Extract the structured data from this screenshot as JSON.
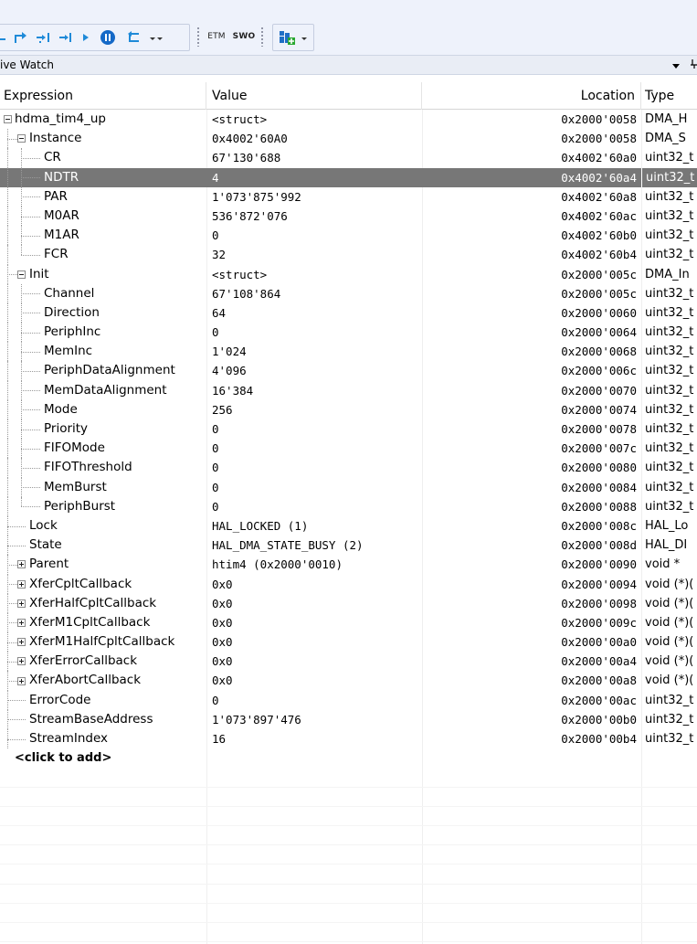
{
  "toolbar": {
    "etm_label": "ETM",
    "swo_label": "SWO"
  },
  "panel": {
    "title": "ive Watch"
  },
  "columns": {
    "expression": "Expression",
    "value": "Value",
    "location": "Location",
    "type": "Type"
  },
  "rows": [
    {
      "expr": "hdma_tim4_up",
      "value": "<struct>",
      "location": "0x2000'0058",
      "type": "DMA_H",
      "depth": 0,
      "expander": "minus"
    },
    {
      "expr": "Instance",
      "value": "0x4002'60A0",
      "location": "0x2000'0058",
      "type": "DMA_S",
      "depth": 1,
      "expander": "minus"
    },
    {
      "expr": "CR",
      "value": "67'130'688",
      "location": "0x4002'60a0",
      "type": "uint32_t",
      "depth": 2,
      "expander": "none"
    },
    {
      "expr": "NDTR",
      "value": "4",
      "location": "0x4002'60a4",
      "type": "uint32_t",
      "depth": 2,
      "expander": "none",
      "selected": true
    },
    {
      "expr": "PAR",
      "value": "1'073'875'992",
      "location": "0x4002'60a8",
      "type": "uint32_t",
      "depth": 2,
      "expander": "none"
    },
    {
      "expr": "M0AR",
      "value": "536'872'076",
      "location": "0x4002'60ac",
      "type": "uint32_t",
      "depth": 2,
      "expander": "none"
    },
    {
      "expr": "M1AR",
      "value": "0",
      "location": "0x4002'60b0",
      "type": "uint32_t",
      "depth": 2,
      "expander": "none"
    },
    {
      "expr": "FCR",
      "value": "32",
      "location": "0x4002'60b4",
      "type": "uint32_t",
      "depth": 2,
      "expander": "none",
      "last": true
    },
    {
      "expr": "Init",
      "value": "<struct>",
      "location": "0x2000'005c",
      "type": "DMA_In",
      "depth": 1,
      "expander": "minus"
    },
    {
      "expr": "Channel",
      "value": "67'108'864",
      "location": "0x2000'005c",
      "type": "uint32_t",
      "depth": 2,
      "expander": "none"
    },
    {
      "expr": "Direction",
      "value": "64",
      "location": "0x2000'0060",
      "type": "uint32_t",
      "depth": 2,
      "expander": "none"
    },
    {
      "expr": "PeriphInc",
      "value": "0",
      "location": "0x2000'0064",
      "type": "uint32_t",
      "depth": 2,
      "expander": "none"
    },
    {
      "expr": "MemInc",
      "value": "1'024",
      "location": "0x2000'0068",
      "type": "uint32_t",
      "depth": 2,
      "expander": "none"
    },
    {
      "expr": "PeriphDataAlignment",
      "value": "4'096",
      "location": "0x2000'006c",
      "type": "uint32_t",
      "depth": 2,
      "expander": "none"
    },
    {
      "expr": "MemDataAlignment",
      "value": "16'384",
      "location": "0x2000'0070",
      "type": "uint32_t",
      "depth": 2,
      "expander": "none"
    },
    {
      "expr": "Mode",
      "value": "256",
      "location": "0x2000'0074",
      "type": "uint32_t",
      "depth": 2,
      "expander": "none"
    },
    {
      "expr": "Priority",
      "value": "0",
      "location": "0x2000'0078",
      "type": "uint32_t",
      "depth": 2,
      "expander": "none"
    },
    {
      "expr": "FIFOMode",
      "value": "0",
      "location": "0x2000'007c",
      "type": "uint32_t",
      "depth": 2,
      "expander": "none"
    },
    {
      "expr": "FIFOThreshold",
      "value": "0",
      "location": "0x2000'0080",
      "type": "uint32_t",
      "depth": 2,
      "expander": "none"
    },
    {
      "expr": "MemBurst",
      "value": "0",
      "location": "0x2000'0084",
      "type": "uint32_t",
      "depth": 2,
      "expander": "none"
    },
    {
      "expr": "PeriphBurst",
      "value": "0",
      "location": "0x2000'0088",
      "type": "uint32_t",
      "depth": 2,
      "expander": "none",
      "last": true
    },
    {
      "expr": "Lock",
      "value": "HAL_LOCKED (1)",
      "location": "0x2000'008c",
      "type": "HAL_Lo",
      "depth": 1,
      "expander": "none"
    },
    {
      "expr": "State",
      "value": "HAL_DMA_STATE_BUSY (2)",
      "location": "0x2000'008d",
      "type": "HAL_DI",
      "depth": 1,
      "expander": "none"
    },
    {
      "expr": "Parent",
      "value": "htim4 (0x2000'0010)",
      "location": "0x2000'0090",
      "type": "void *",
      "depth": 1,
      "expander": "plus"
    },
    {
      "expr": "XferCpltCallback",
      "value": "0x0",
      "location": "0x2000'0094",
      "type": "void (*)(",
      "depth": 1,
      "expander": "plus"
    },
    {
      "expr": "XferHalfCpltCallback",
      "value": "0x0",
      "location": "0x2000'0098",
      "type": "void (*)(",
      "depth": 1,
      "expander": "plus"
    },
    {
      "expr": "XferM1CpltCallback",
      "value": "0x0",
      "location": "0x2000'009c",
      "type": "void (*)(",
      "depth": 1,
      "expander": "plus"
    },
    {
      "expr": "XferM1HalfCpltCallback",
      "value": "0x0",
      "location": "0x2000'00a0",
      "type": "void (*)(",
      "depth": 1,
      "expander": "plus"
    },
    {
      "expr": "XferErrorCallback",
      "value": "0x0",
      "location": "0x2000'00a4",
      "type": "void (*)(",
      "depth": 1,
      "expander": "plus"
    },
    {
      "expr": "XferAbortCallback",
      "value": "0x0",
      "location": "0x2000'00a8",
      "type": "void (*)(",
      "depth": 1,
      "expander": "plus"
    },
    {
      "expr": "ErrorCode",
      "value": "0",
      "location": "0x2000'00ac",
      "type": "uint32_t",
      "depth": 1,
      "expander": "none"
    },
    {
      "expr": "StreamBaseAddress",
      "value": "1'073'897'476",
      "location": "0x2000'00b0",
      "type": "uint32_t",
      "depth": 1,
      "expander": "none"
    },
    {
      "expr": "StreamIndex",
      "value": "16",
      "location": "0x2000'00b4",
      "type": "uint32_t",
      "depth": 1,
      "expander": "none",
      "last": true
    }
  ],
  "add_row": "<click to add>",
  "colors": {
    "selection": "#777777",
    "toolbar_bg": "#eef2fb",
    "run_button": "#1569c7",
    "arrow_blue": "#1f8ad8"
  }
}
